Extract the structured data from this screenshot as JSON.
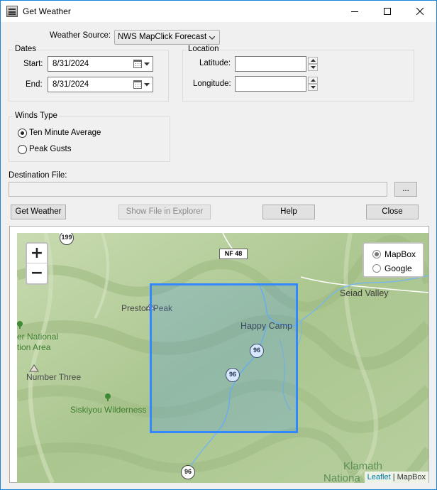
{
  "window": {
    "title": "Get Weather"
  },
  "form": {
    "weather_source_label": "Weather Source:",
    "weather_source_value": "NWS MapClick Forecast",
    "dates": {
      "group_title": "Dates",
      "start_label": "Start:",
      "start_value": "8/31/2024",
      "end_label": "End:",
      "end_value": "8/31/2024"
    },
    "location": {
      "group_title": "Location",
      "latitude_label": "Latitude:",
      "latitude_value": "",
      "longitude_label": "Longitude:",
      "longitude_value": ""
    },
    "winds_type": {
      "group_title": "Winds Type",
      "options": [
        {
          "label": "Ten Minute Average",
          "selected": true
        },
        {
          "label": "Peak Gusts",
          "selected": false
        }
      ]
    },
    "destination_label": "Destination File:",
    "destination_value": "",
    "browse_label": "..."
  },
  "buttons": {
    "get_weather": "Get Weather",
    "show_file": "Show File in Explorer",
    "help": "Help",
    "close": "Close"
  },
  "map": {
    "zoom_in": "+",
    "zoom_out": "−",
    "layers": [
      {
        "label": "MapBox",
        "selected": true
      },
      {
        "label": "Google",
        "selected": false
      }
    ],
    "labels": {
      "route_199": "199",
      "nf48": "NF 48",
      "preston_peak": "Preston Peak",
      "seiad_valley": "Seiad Valley",
      "happy_camp": "Happy Camp",
      "route_96_a": "96",
      "route_96_b": "96",
      "route_96_c": "96",
      "wilderness_line1": "er National",
      "wilderness_line2": "tion Area",
      "number_three": "Number Three",
      "siskiyou": "Siskiyou Wilderness",
      "klamath_line1": "Klamath",
      "klamath_line2": "Nationa"
    },
    "attribution_leaflet": "Leaflet",
    "attribution_sep": " | ",
    "attribution_mapbox": "MapBox",
    "colors": {
      "selection": "#3388ff",
      "river": "#79b7e8"
    }
  }
}
